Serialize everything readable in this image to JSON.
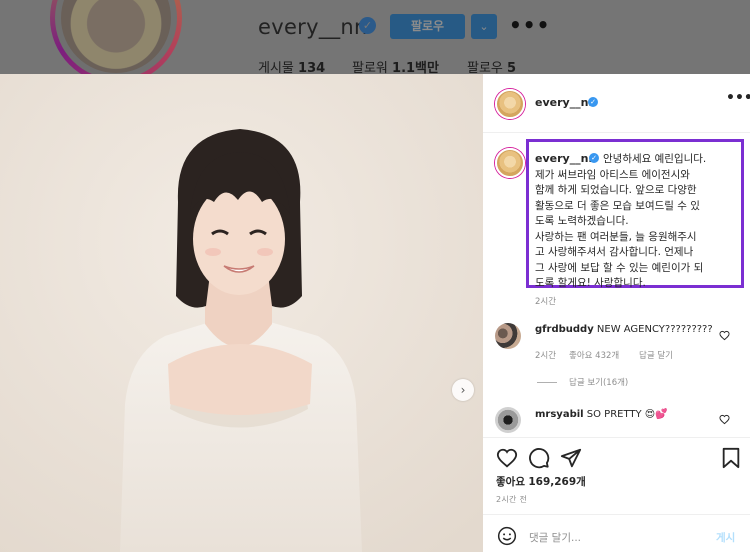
{
  "profile": {
    "username": "every__nn",
    "follow_label": "팔로우",
    "dropdown_glyph": "⌄",
    "more_glyph": "•••",
    "stats": [
      {
        "label": "게시물",
        "value": "134"
      },
      {
        "label": "팔로워",
        "value": "1.1백만"
      },
      {
        "label": "팔로우",
        "value": "5"
      }
    ]
  },
  "post": {
    "username": "every__nn",
    "more_glyph": "•••",
    "caption": "안녕하세요 예린입니다.\n제가 써브라임 아티스트 에이전시와\n함께 하게 되었습니다. 앞으로 다양한\n활동으로 더 좋은 모습 보여드릴 수 있\n도록 노력하겠습니다.\n사랑하는 팬 여러분들, 늘 응원해주시\n고 사랑해주셔서 감사합니다. 언제나\n그 사랑에 보답 할 수 있는 예린이가 되\n도록 할게요! 사랑합니다.",
    "caption_time": "2시간",
    "next_glyph": "›",
    "likes_label": "좋아요",
    "likes_count": "169,269개",
    "time_ago": "2시간 전",
    "comment_placeholder": "댓글 달기...",
    "post_button": "게시"
  },
  "comments": [
    {
      "username": "gfrdbuddy",
      "text": "NEW AGENCY?????????",
      "time": "2시간",
      "likes": "좋아요 432개",
      "reply": "답글 달기",
      "replies_link": "답글 보기(16개)"
    },
    {
      "username": "mrsyabil",
      "text": "SO PRETTY 😍💕"
    }
  ],
  "colors": {
    "highlight_border": "#7b2fd2",
    "verified": "#3897f0",
    "photo_bg": "#ece4db"
  }
}
